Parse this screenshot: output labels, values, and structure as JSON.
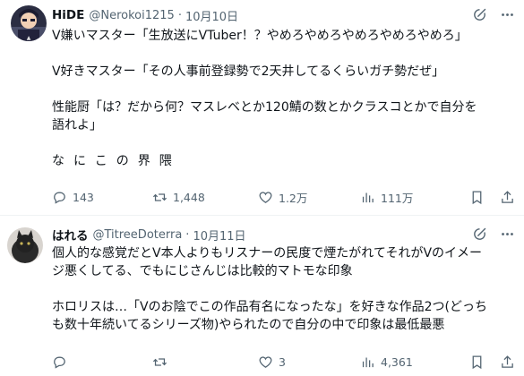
{
  "posts": [
    {
      "name": "HiDE",
      "handle": "@Nerokoi1215",
      "sep": "·",
      "date": "10月10日",
      "lines": [
        "V嫌いマスター「生放送にVTuber！？やめろやめろやめろやめろやめろ」",
        "",
        "V好きマスター「その人事前登録勢で2天井してるくらいガチ勢だぜ」",
        "",
        "性能厨「は？だから何？マスレベとか120鯖の数とかクラスコとかで自分を",
        "語れよ」",
        "",
        "なにこの界隈"
      ],
      "replies": "143",
      "reposts": "1,448",
      "likes": "1.2万",
      "views": "111万"
    },
    {
      "name": "はれる",
      "handle": "@TitreeDoterra",
      "sep": "·",
      "date": "10月11日",
      "lines": [
        "個人的な感覚だとV本人よりもリスナーの民度で煙たがれてそれがVのイメー",
        "ジ悪くしてる、でもにじさんじは比較的マトモな印象",
        "",
        "ホロリスは…「Vのお陰でこの作品有名になったな」を好きな作品2つ(どっち",
        "も数十年続いてるシリーズ物)やられたので自分の中で印象は最低最悪"
      ],
      "replies": "",
      "reposts": "",
      "likes": "3",
      "views": "4,361"
    }
  ],
  "icons": [
    "grok-icon",
    "more-icon",
    "reply-icon",
    "repost-icon",
    "like-icon",
    "views-icon",
    "bookmark-icon",
    "share-icon"
  ],
  "colors": {
    "text": "#0f1419",
    "secondary": "#536471",
    "divider": "#eff3f4"
  }
}
